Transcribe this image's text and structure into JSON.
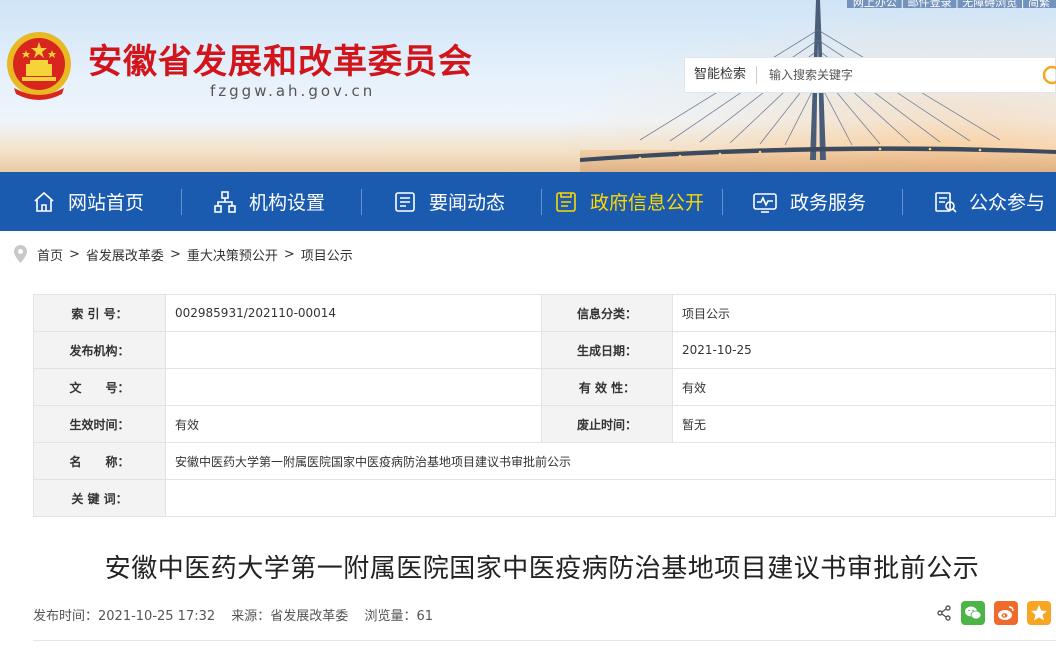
{
  "header": {
    "site_title": "安徽省发展和改革委员会",
    "site_domain": "fzggw.ah.gov.cn",
    "top_links": "网上办公 | 邮件登录 | 无障碍浏览 | 简繁",
    "search": {
      "label": "智能检索",
      "placeholder": "输入搜索关键字"
    }
  },
  "nav": {
    "items": [
      {
        "label": "网站首页",
        "icon": "home-icon"
      },
      {
        "label": "机构设置",
        "icon": "org-chart-icon"
      },
      {
        "label": "要闻动态",
        "icon": "news-icon"
      },
      {
        "label": "政府信息公开",
        "icon": "info-disclosure-icon",
        "active": true
      },
      {
        "label": "政务服务",
        "icon": "service-monitor-icon"
      },
      {
        "label": "公众参与",
        "icon": "participation-icon"
      }
    ],
    "active_color": "#ffd800",
    "bar_color": "#1a5bb0"
  },
  "breadcrumb": [
    "首页",
    "省发展改革委",
    "重大决策预公开",
    "项目公示"
  ],
  "info": {
    "index_no_label": "索 引 号：",
    "index_no": "002985931/202110-00014",
    "category_label": "信息分类：",
    "category": "项目公示",
    "publisher_label": "发布机构：",
    "publisher": "",
    "date_label": "生成日期：",
    "date": "2021-10-25",
    "doc_no_label": "文　　号：",
    "doc_no": "",
    "validity_label": "有 效 性：",
    "validity": "有效",
    "effective_label": "生效时间：",
    "effective": "有效",
    "expiry_label": "废止时间：",
    "expiry": "暂无",
    "name_label": "名　　称：",
    "name": "安徽中医药大学第一附属医院国家中医疫病防治基地项目建议书审批前公示",
    "keywords_label": "关 键 词：",
    "keywords": ""
  },
  "article": {
    "title": "安徽中医药大学第一附属医院国家中医疫病防治基地项目建议书审批前公示",
    "publish_time": "发布时间：2021-10-25 17:32",
    "source": "来源：省发展改革委",
    "views": "浏览量：61"
  },
  "colors": {
    "title_red": "#d2141b",
    "wechat_green": "#4bb548",
    "weibo_orange": "#ef6b2b",
    "qzone_orange": "#f6a623"
  }
}
